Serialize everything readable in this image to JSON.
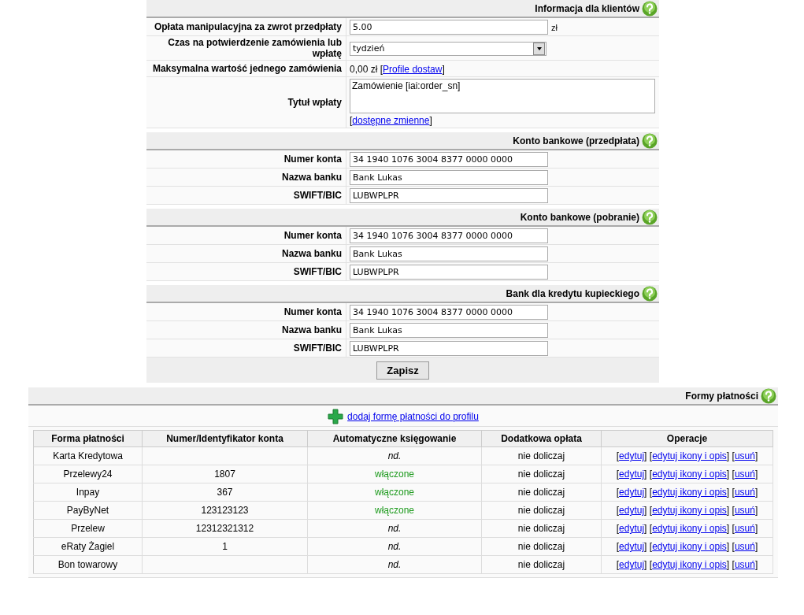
{
  "link_brackets": [
    "[",
    "]"
  ],
  "sections": [
    {
      "title": "Informacja dla klientów",
      "rows": [
        {
          "kind": "input",
          "label": "Opłata manipulacyjna za zwrot przedpłaty",
          "value": "5.00",
          "suffix": "zł"
        },
        {
          "kind": "select",
          "label": "Czas na potwierdzenie zamówienia lub wpłatę",
          "value": "tydzień"
        },
        {
          "kind": "text",
          "label": "Maksymalna wartość jednego zamówienia",
          "value": "0,00 zł",
          "link": "Profile dostaw"
        },
        {
          "kind": "textarea",
          "label": "Tytuł wpłaty",
          "value": "Zamówienie [iai:order_sn]",
          "link": "dostępne zmienne"
        }
      ]
    },
    {
      "title": "Konto bankowe (przedpłata)",
      "rows": [
        {
          "kind": "input",
          "label": "Numer konta",
          "value": "34 1940 1076 3004 8377 0000 0000"
        },
        {
          "kind": "input",
          "label": "Nazwa banku",
          "value": "Bank Lukas"
        },
        {
          "kind": "input",
          "label": "SWIFT/BIC",
          "value": "LUBWPLPR"
        }
      ]
    },
    {
      "title": "Konto bankowe (pobranie)",
      "rows": [
        {
          "kind": "input",
          "label": "Numer konta",
          "value": "34 1940 1076 3004 8377 0000 0000"
        },
        {
          "kind": "input",
          "label": "Nazwa banku",
          "value": "Bank Lukas"
        },
        {
          "kind": "input",
          "label": "SWIFT/BIC",
          "value": "LUBWPLPR"
        }
      ]
    },
    {
      "title": "Bank dla kredytu kupieckiego",
      "rows": [
        {
          "kind": "input",
          "label": "Numer konta",
          "value": "34 1940 1076 3004 8377 0000 0000"
        },
        {
          "kind": "input",
          "label": "Nazwa banku",
          "value": "Bank Lukas"
        },
        {
          "kind": "input",
          "label": "SWIFT/BIC",
          "value": "LUBWPLPR"
        }
      ]
    }
  ],
  "save_button": "Zapisz",
  "payments": {
    "title": "Formy płatności",
    "add_link": "dodaj formę płatności do profilu",
    "columns": [
      "Forma płatności",
      "Numer/Identyfikator konta",
      "Automatyczne księgowanie",
      "Dodatkowa opłata",
      "Operacje"
    ],
    "rows": [
      {
        "name": "Karta Kredytowa",
        "account": "",
        "auto": {
          "kind": "na",
          "text": "nd."
        },
        "fee": "nie doliczaj",
        "operations": [
          "edytuj",
          "edytuj ikony i opis",
          "usuń"
        ]
      },
      {
        "name": "Przelewy24",
        "account": "1807",
        "auto": {
          "kind": "on",
          "text": "włączone"
        },
        "fee": "nie doliczaj",
        "operations": [
          "edytuj",
          "edytuj ikony i opis",
          "usuń"
        ]
      },
      {
        "name": "Inpay",
        "account": "367",
        "auto": {
          "kind": "on",
          "text": "włączone"
        },
        "fee": "nie doliczaj",
        "operations": [
          "edytuj",
          "edytuj ikony i opis",
          "usuń"
        ]
      },
      {
        "name": "PayByNet",
        "account": "123123123",
        "auto": {
          "kind": "on",
          "text": "włączone"
        },
        "fee": "nie doliczaj",
        "operations": [
          "edytuj",
          "edytuj ikony i opis",
          "usuń"
        ]
      },
      {
        "name": "Przelew",
        "account": "12312321312",
        "auto": {
          "kind": "na",
          "text": "nd."
        },
        "fee": "nie doliczaj",
        "operations": [
          "edytuj",
          "edytuj ikony i opis",
          "usuń"
        ]
      },
      {
        "name": "eRaty Żagiel",
        "account": "1",
        "auto": {
          "kind": "na",
          "text": "nd."
        },
        "fee": "nie doliczaj",
        "operations": [
          "edytuj",
          "edytuj ikony i opis",
          "usuń"
        ]
      },
      {
        "name": "Bon towarowy",
        "account": "",
        "auto": {
          "kind": "na",
          "text": "nd."
        },
        "fee": "nie doliczaj",
        "operations": [
          "edytuj",
          "edytuj ikony i opis",
          "usuń"
        ]
      }
    ]
  }
}
